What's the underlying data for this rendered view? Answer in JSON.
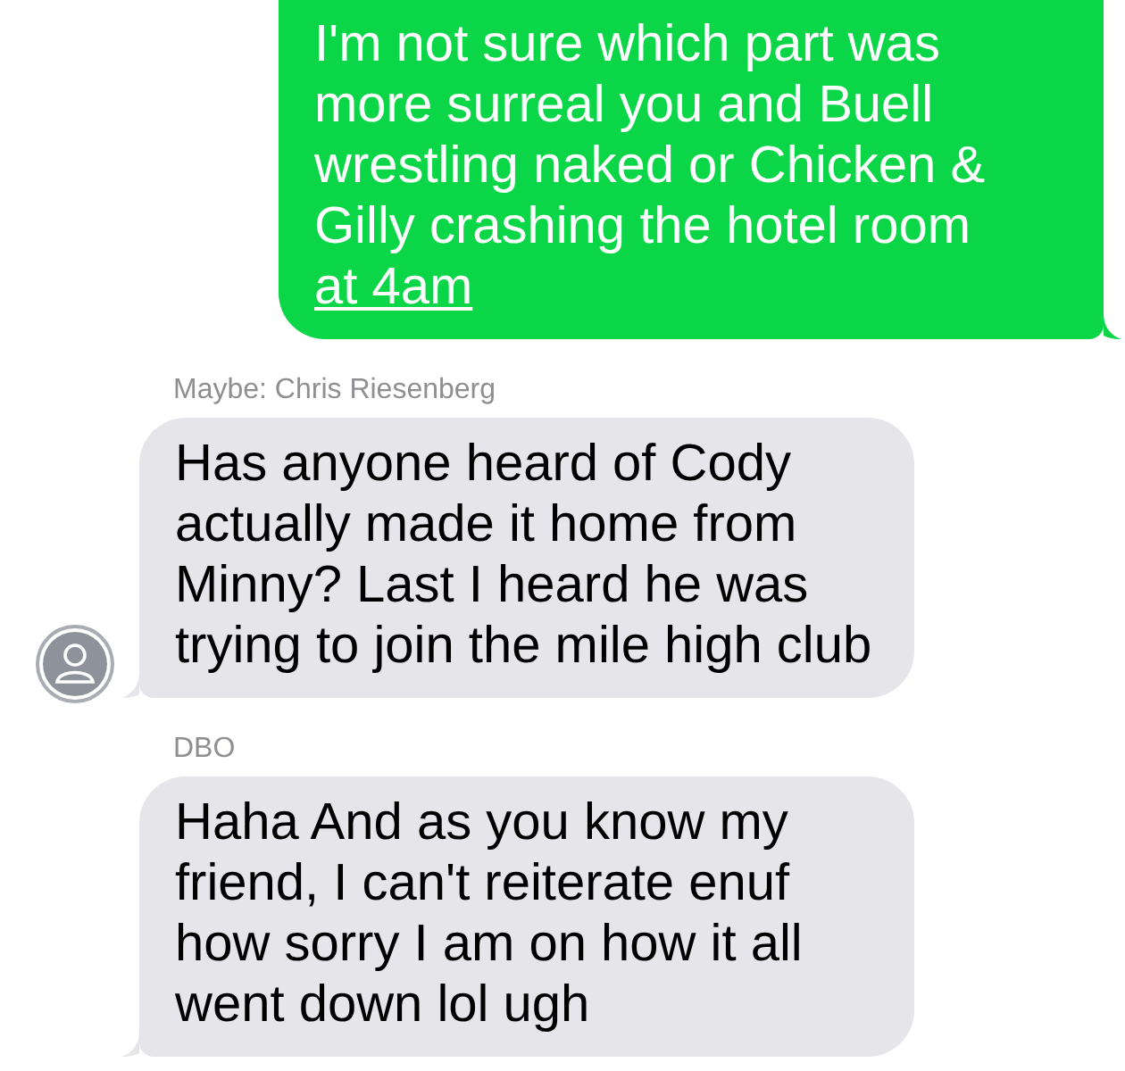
{
  "messages": [
    {
      "kind": "outgoing",
      "text": "I'm not sure which part was more surreal you and Buell wrestling naked or Chicken & Gilly crashing the hotel room",
      "link": "at 4am"
    },
    {
      "kind": "incoming",
      "sender": "Maybe: Chris Riesenberg",
      "text": "Has anyone heard of Cody actually made it home from Minny?  Last I heard he was trying to join the mile high club",
      "avatar": true
    },
    {
      "kind": "incoming",
      "sender": "DBO",
      "text": "Haha And as you know my friend, I can't reiterate enuf how sorry I am on how it all went down lol ugh",
      "avatar": false
    }
  ]
}
